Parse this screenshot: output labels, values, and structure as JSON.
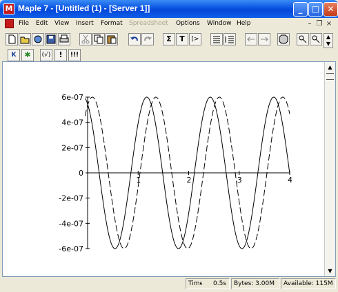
{
  "window": {
    "title": "Maple 7  - [Untitled (1) - [Server 1]]",
    "app_icon_letter": "M",
    "controls": {
      "minimize": "_",
      "maximize": "□",
      "close": "✕"
    }
  },
  "menubar": {
    "items": [
      "File",
      "Edit",
      "View",
      "Insert",
      "Format",
      "Spreadsheet",
      "Options",
      "Window",
      "Help"
    ],
    "disabled": [
      "Spreadsheet"
    ],
    "mdi_controls": {
      "minimize": "–",
      "restore": "❐",
      "close": "×"
    }
  },
  "toolbar": {
    "buttons": [
      "new-icon",
      "open-icon",
      "open-url-icon",
      "save-icon",
      "print-icon",
      "cut-icon",
      "copy-icon",
      "paste-icon",
      "undo-icon",
      "redo-icon",
      "sigma-icon",
      "text-icon",
      "input-icon",
      "insert-group-icon",
      "remove-group-icon",
      "back-icon",
      "forward-icon",
      "stop-icon",
      "zoom-in-icon",
      "zoom-out-icon",
      "expand-icon"
    ],
    "glyphs": {
      "sigma": "Σ",
      "text": "T",
      "input": "[>"
    }
  },
  "context_bar": {
    "glyphs": [
      "K",
      "✱",
      "(√)",
      "!",
      "!!!"
    ]
  },
  "plot": {
    "chart_data": {
      "type": "line",
      "title": "",
      "xlabel": "",
      "ylabel": "",
      "xlim": [
        0,
        4
      ],
      "ylim": [
        -6e-07,
        6e-07
      ],
      "x_ticks": [
        "1",
        "2",
        "3",
        "4"
      ],
      "y_ticks": [
        "6e-07",
        "4e-07",
        "2e-07",
        "0",
        "-2e-07",
        "-4e-07",
        "-6e-07"
      ],
      "series": [
        {
          "name": "",
          "style": "solid",
          "amplitude": 6e-07,
          "angular_frequency": 5,
          "phase": 2.0,
          "x_range": [
            -0.05,
            4
          ]
        },
        {
          "name": "",
          "style": "dashed",
          "amplitude": 6e-07,
          "angular_frequency": 5,
          "phase": 1.1,
          "x_range": [
            -0.05,
            4
          ]
        }
      ]
    }
  },
  "statusbar": {
    "time_label": "Time:",
    "time_value": "0.5s",
    "bytes": "Bytes: 3.00M",
    "available": "Available: 115M"
  }
}
